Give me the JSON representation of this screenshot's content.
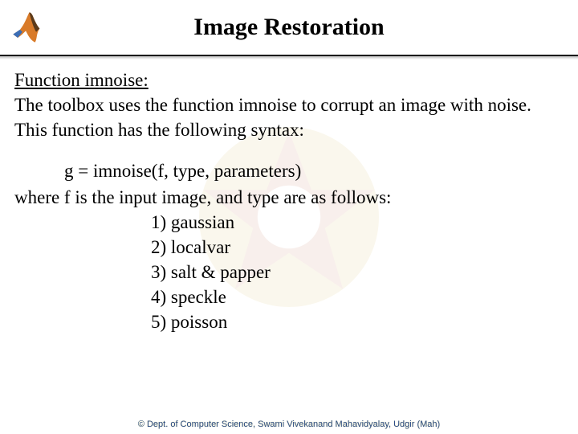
{
  "header": {
    "title": "Image Restoration",
    "logo_alt": "matlab-logo"
  },
  "body": {
    "function_heading": "Function imnoise:",
    "description": "The toolbox uses the function imnoise to corrupt an image with noise. This function has the following syntax:",
    "syntax_line": "g = imnoise(f, type, parameters)",
    "where_line": "where f is the input image, and type are as follows:",
    "types": {
      "t1": "1) gaussian",
      "t2": "2) localvar",
      "t3": "3) salt & papper",
      "t4": "4) speckle",
      "t5": "5) poisson"
    }
  },
  "footer": {
    "credit": "© Dept. of Computer Science, Swami Vivekanand Mahavidyalay, Udgir (Mah)"
  }
}
